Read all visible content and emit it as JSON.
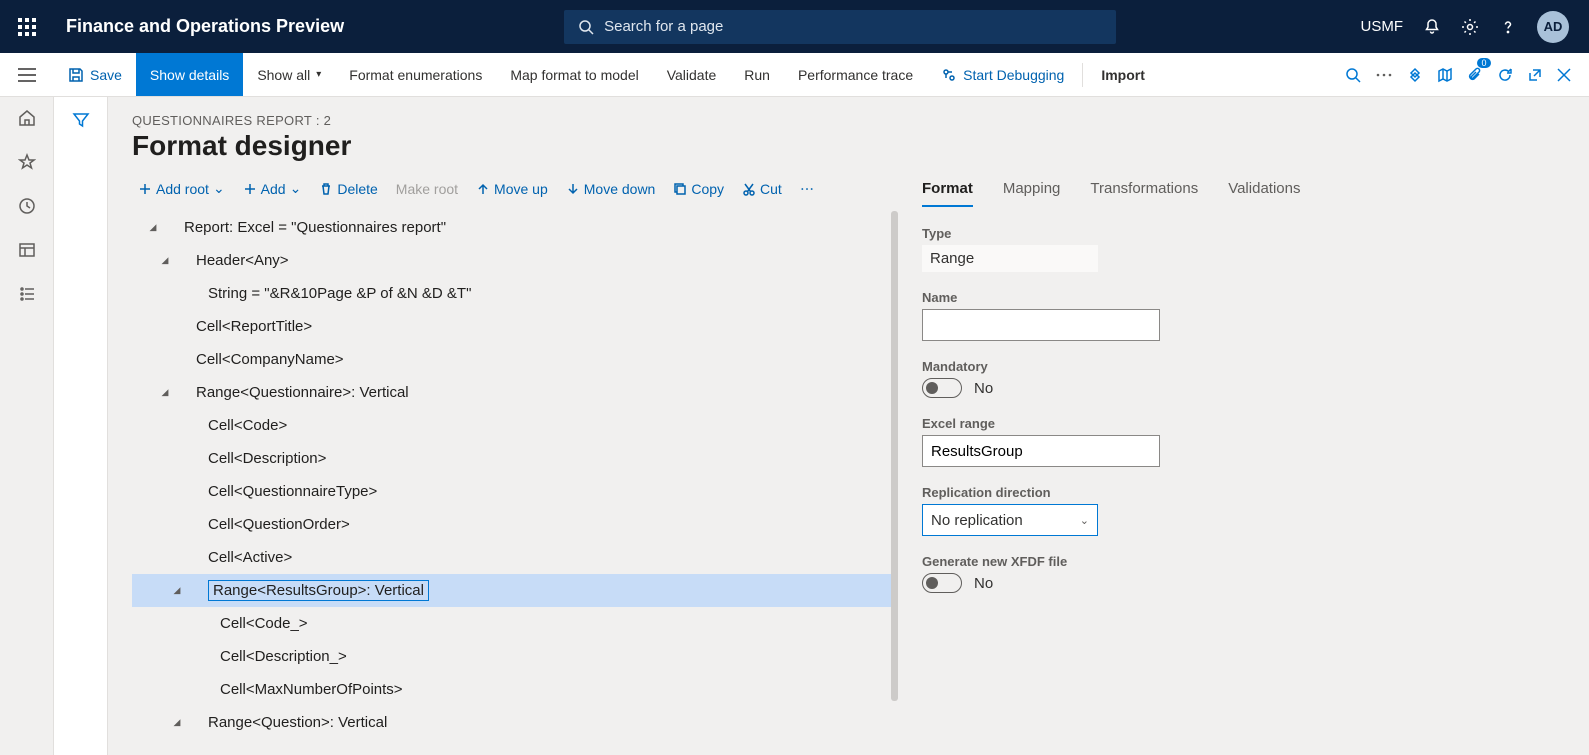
{
  "header": {
    "app_name": "Finance and Operations Preview",
    "search_placeholder": "Search for a page",
    "company": "USMF",
    "avatar": "AD"
  },
  "cmdbar": {
    "save": "Save",
    "show_details": "Show details",
    "show_all": "Show all",
    "format_enum": "Format enumerations",
    "map_format": "Map format to model",
    "validate": "Validate",
    "run": "Run",
    "perf": "Performance trace",
    "debug": "Start Debugging",
    "import": "Import",
    "badge": "0"
  },
  "page": {
    "breadcrumb": "QUESTIONNAIRES REPORT : 2",
    "title": "Format designer"
  },
  "toolbar2": {
    "add_root": "Add root",
    "add": "Add",
    "delete": "Delete",
    "make_root": "Make root",
    "move_up": "Move up",
    "move_down": "Move down",
    "copy": "Copy",
    "cut": "Cut"
  },
  "tree": [
    {
      "depth": 0,
      "caret": true,
      "text": "Report: Excel = \"Questionnaires report\""
    },
    {
      "depth": 1,
      "caret": true,
      "text": "Header<Any>"
    },
    {
      "depth": 2,
      "caret": false,
      "text": "String = \"&R&10Page &P of &N &D &T\""
    },
    {
      "depth": 1,
      "caret": false,
      "text": "Cell<ReportTitle>"
    },
    {
      "depth": 1,
      "caret": false,
      "text": "Cell<CompanyName>"
    },
    {
      "depth": 1,
      "caret": true,
      "text": "Range<Questionnaire>: Vertical"
    },
    {
      "depth": 2,
      "caret": false,
      "text": "Cell<Code>"
    },
    {
      "depth": 2,
      "caret": false,
      "text": "Cell<Description>"
    },
    {
      "depth": 2,
      "caret": false,
      "text": "Cell<QuestionnaireType>"
    },
    {
      "depth": 2,
      "caret": false,
      "text": "Cell<QuestionOrder>"
    },
    {
      "depth": 2,
      "caret": false,
      "text": "Cell<Active>"
    },
    {
      "depth": 2,
      "caret": true,
      "text": "Range<ResultsGroup>: Vertical",
      "selected": true
    },
    {
      "depth": 3,
      "caret": false,
      "text": "Cell<Code_>"
    },
    {
      "depth": 3,
      "caret": false,
      "text": "Cell<Description_>"
    },
    {
      "depth": 3,
      "caret": false,
      "text": "Cell<MaxNumberOfPoints>"
    },
    {
      "depth": 2,
      "caret": true,
      "text": "Range<Question>: Vertical"
    }
  ],
  "tabs": {
    "format": "Format",
    "mapping": "Mapping",
    "transformations": "Transformations",
    "validations": "Validations"
  },
  "props": {
    "type_label": "Type",
    "type_value": "Range",
    "name_label": "Name",
    "name_value": "",
    "mandatory_label": "Mandatory",
    "mandatory_value": "No",
    "excel_label": "Excel range",
    "excel_value": "ResultsGroup",
    "repl_label": "Replication direction",
    "repl_value": "No replication",
    "xfdf_label": "Generate new XFDF file",
    "xfdf_value": "No"
  }
}
